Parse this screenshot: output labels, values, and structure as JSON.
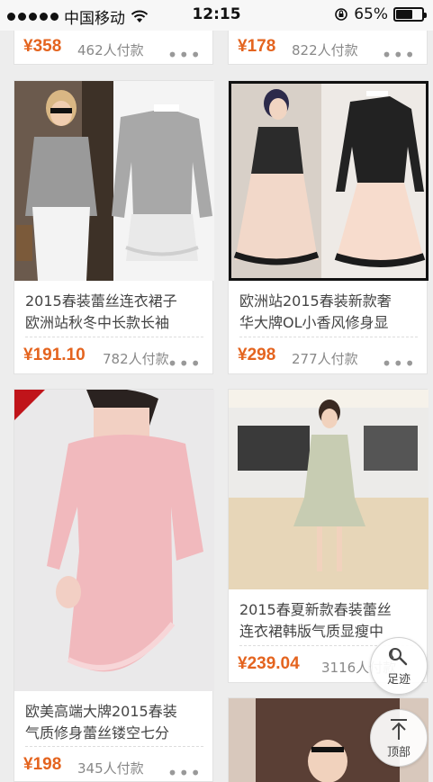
{
  "status_bar": {
    "carrier": "中国移动",
    "time": "12:15",
    "battery": "65%",
    "battery_level": 0.65
  },
  "products": [
    {
      "title": "",
      "price": "¥358",
      "paid": "462人付款"
    },
    {
      "title": "",
      "price": "¥178",
      "paid": "822人付款"
    },
    {
      "title_line1": "2015春装蕾丝连衣裙子",
      "title_line2": "欧洲站秋冬中长款长袖",
      "price": "¥191.10",
      "paid": "782人付款"
    },
    {
      "title_line1": "欧洲站2015春装新款奢",
      "title_line2": "华大牌OL小香风修身显",
      "price": "¥298",
      "paid": "277人付款"
    },
    {
      "title_line1": "欧美高端大牌2015春装",
      "title_line2": "气质修身蕾丝镂空七分",
      "price": "¥198",
      "paid": "345人付款"
    },
    {
      "title_line1": "2015春夏新款春装蕾丝",
      "title_line2": "连衣裙韩版气质显瘦中",
      "price": "¥239.04",
      "paid": "3116人付款"
    }
  ],
  "more_label": "•••",
  "fab": {
    "history_label": "足迹",
    "top_label": "顶部"
  }
}
